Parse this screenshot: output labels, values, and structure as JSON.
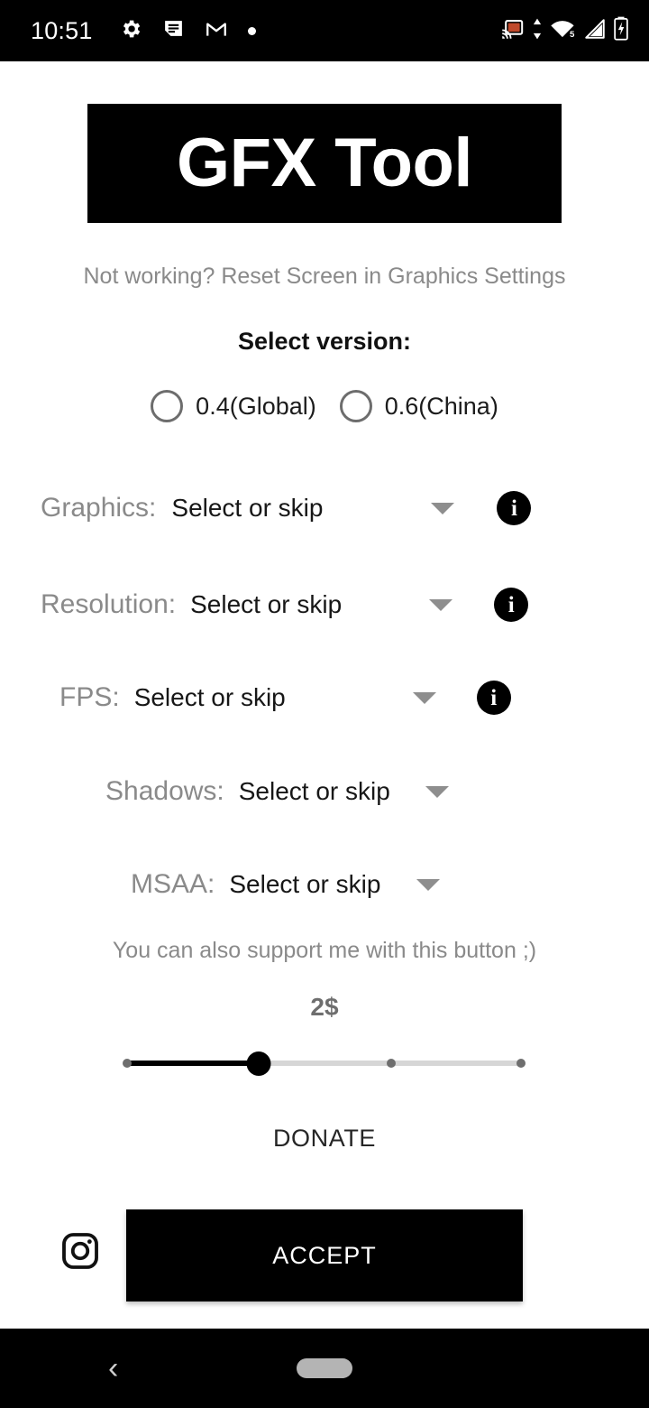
{
  "status_bar": {
    "time": "10:51",
    "left_icons": [
      "gear-icon",
      "notes-icon",
      "gmail-icon",
      "dot-icon"
    ],
    "right_icons": [
      "cast-icon",
      "data-transfer-icon",
      "wifi-icon",
      "signal-icon",
      "battery-charging-icon"
    ],
    "wifi_label": "5",
    "cast_color": "#c0492b",
    "background": "#000000"
  },
  "app": {
    "logo_text": "GFX Tool",
    "logo_background": "#000000",
    "logo_foreground": "#ffffff"
  },
  "hint": {
    "text": "Not working? Reset Screen in Graphics Settings"
  },
  "version_section": {
    "heading": "Select version:",
    "options": [
      {
        "label": "0.4(Global)",
        "selected": false
      },
      {
        "label": "0.6(China)",
        "selected": false
      }
    ]
  },
  "settings": {
    "rows": [
      {
        "label": "Graphics:",
        "value": "Select or skip",
        "has_info": true
      },
      {
        "label": "Resolution:",
        "value": "Select or skip",
        "has_info": true
      },
      {
        "label": "FPS:",
        "value": "Select or skip",
        "has_info": true
      },
      {
        "label": "Shadows:",
        "value": "Select or skip",
        "has_info": false
      },
      {
        "label": "MSAA:",
        "value": "Select or skip",
        "has_info": false
      }
    ],
    "info_badge_char": "i"
  },
  "donate": {
    "hint": "You can also support me with this button ;)",
    "amount_label": "2$",
    "slider": {
      "steps": 4,
      "selected_index": 1,
      "fill_color": "#000000",
      "track_color": "#d6d6d6"
    },
    "button_label": "DONATE"
  },
  "actions": {
    "instagram_icon": "instagram-icon",
    "accept_label": "ACCEPT",
    "accept_background": "#000000"
  },
  "nav_bar": {
    "back_glyph": "‹",
    "home_pill": "home-pill"
  }
}
